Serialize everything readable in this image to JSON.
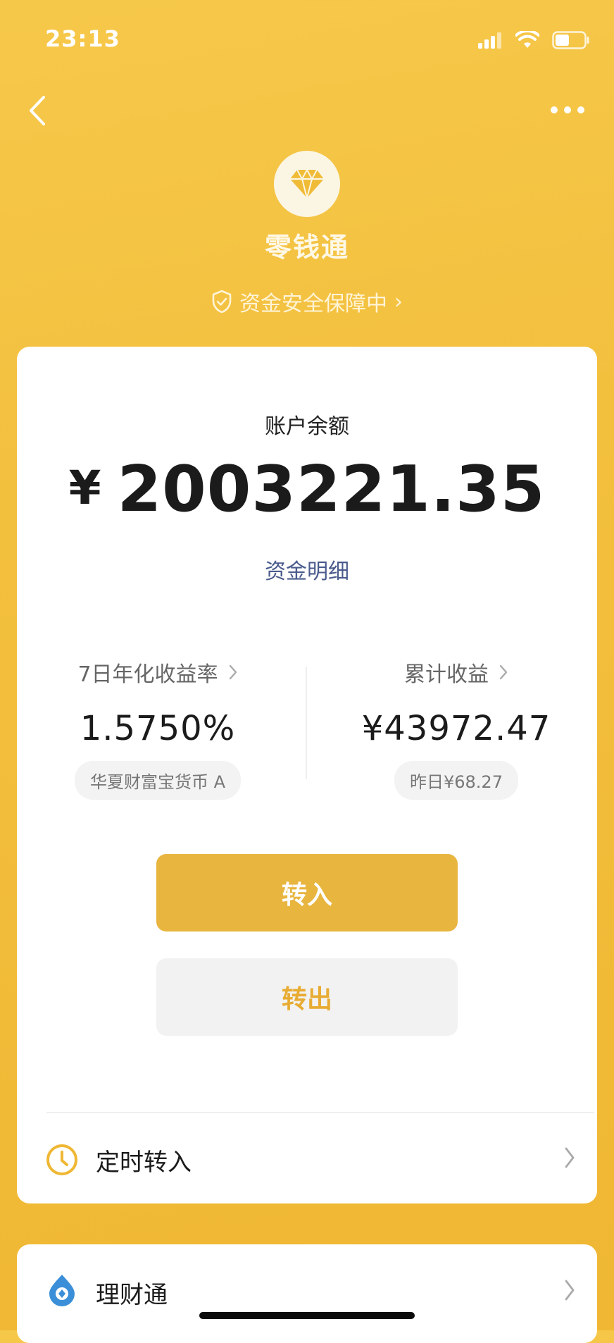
{
  "status_bar": {
    "time": "23:13"
  },
  "header": {
    "title": "零钱通",
    "safety_text": "资金安全保障中",
    "safety_chevron": "›"
  },
  "balance": {
    "label": "账户余额",
    "currency": "¥",
    "amount": "2003221.35",
    "detail_link": "资金明细"
  },
  "stats": {
    "yield_label": "7日年化收益率",
    "yield_value": "1.5750%",
    "fund_name": "华夏财富宝货币 A",
    "earnings_label": "累计收益",
    "earnings_value": "¥43972.47",
    "yesterday": "昨日¥68.27"
  },
  "actions": {
    "transfer_in": "转入",
    "transfer_out": "转出"
  },
  "scheduled": {
    "label": "定时转入"
  },
  "wealth": {
    "label": "理财通"
  },
  "colors": {
    "background": "#f3c03e",
    "primary_button": "#e8b53f",
    "secondary_text_button": "#e8ac33",
    "link": "#4a5b8c"
  },
  "icons": {
    "back": "chevron-left-icon",
    "more": "more-dots-icon",
    "logo": "diamond-icon",
    "safety": "shield-check-icon",
    "clock": "clock-icon",
    "wealth": "wealth-drop-icon"
  }
}
